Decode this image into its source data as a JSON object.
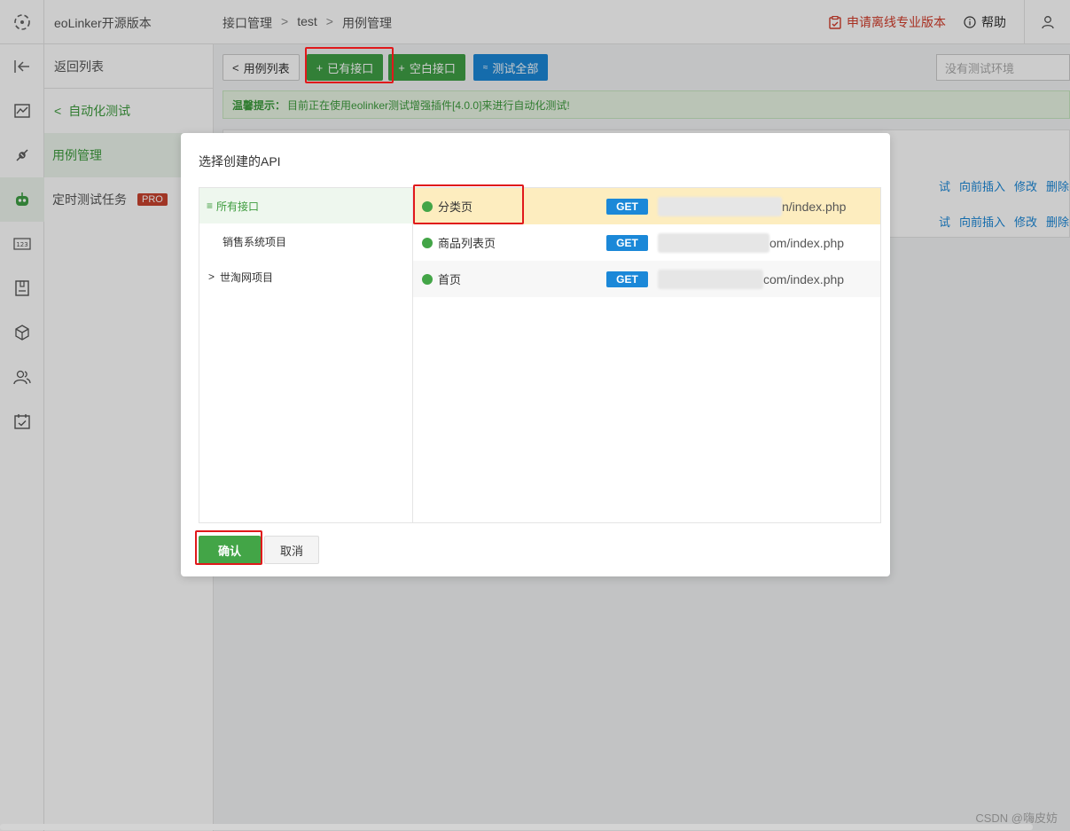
{
  "app": {
    "brand": "eoLinker开源版本",
    "breadcrumb": [
      "接口管理",
      "test",
      "用例管理"
    ],
    "apply_pro": "申请离线专业版本",
    "help": "帮助"
  },
  "subnav": {
    "back": "返回列表",
    "group": "自动化测试",
    "items": [
      "用例管理",
      "定时测试任务"
    ],
    "pro_badge": "PRO"
  },
  "toolbar": {
    "case_list": "用例列表",
    "existing_api": "已有接口",
    "blank_api": "空白接口",
    "test_all": "测试全部",
    "env_placeholder": "没有测试环境"
  },
  "tip": {
    "label": "温馨提示：",
    "text": "目前正在使用eolinker测试增强插件[4.0.0]来进行自动化测试!"
  },
  "row_actions": [
    "试",
    "向前插入",
    "修改",
    "删除"
  ],
  "modal": {
    "title": "选择创建的API",
    "tree": {
      "all": "所有接口",
      "projects": [
        "销售系统项目",
        "世淘网项目"
      ]
    },
    "apis": [
      {
        "name": "分类页",
        "method": "GET",
        "url": "n/index.php"
      },
      {
        "name": "商品列表页",
        "method": "GET",
        "url": "om/index.php"
      },
      {
        "name": "首页",
        "method": "GET",
        "url": "com/index.php"
      }
    ],
    "confirm": "确认",
    "cancel": "取消"
  },
  "watermark": "CSDN @嗨皮妨",
  "colors": {
    "primary_green": "#43a547",
    "blue": "#1b88d8",
    "highlight": "#e0191b",
    "selected_row": "#fdedbf"
  }
}
